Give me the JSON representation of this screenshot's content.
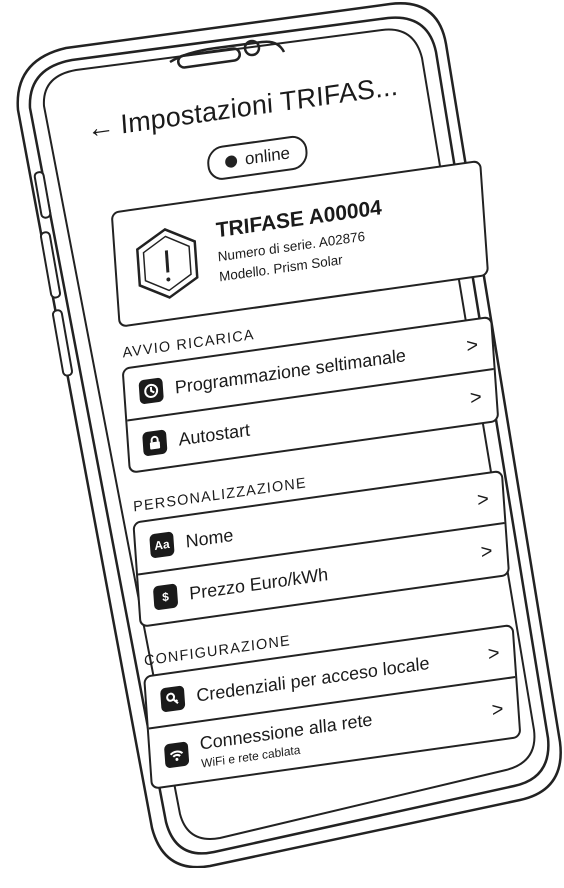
{
  "header": {
    "back_icon": "arrow-left-icon",
    "title": "Impostazioni TRIFAS..."
  },
  "status": {
    "label": "online"
  },
  "device": {
    "name": "TRIFASE A00004",
    "serial": "Numero di serie. A02876",
    "model": "Modello. Prism Solar",
    "icon": "warning-hexagon-icon"
  },
  "sections": {
    "avvio": {
      "title": "Avvio ricarica",
      "items": [
        {
          "label": "Programmazione seltimanale",
          "icon": "clock-icon"
        },
        {
          "label": "Autostart",
          "icon": "lock-icon"
        }
      ]
    },
    "personalizzazione": {
      "title": "Personalizzazione",
      "items": [
        {
          "label": "Nome",
          "icon": "text-aa-icon"
        },
        {
          "label": "Prezzo Euro/kWh",
          "icon": "dollar-icon"
        }
      ]
    },
    "configurazione": {
      "title": "Configurazione",
      "items": [
        {
          "label": "Credenziali per acceso locale",
          "icon": "key-icon"
        },
        {
          "label": "Connessione alla rete",
          "sublabel": "WiFi e rete cablata",
          "icon": "wifi-icon"
        }
      ]
    }
  },
  "icons": {
    "chevron": ">",
    "back": "←",
    "aa": "Aa",
    "dollar": "$"
  }
}
